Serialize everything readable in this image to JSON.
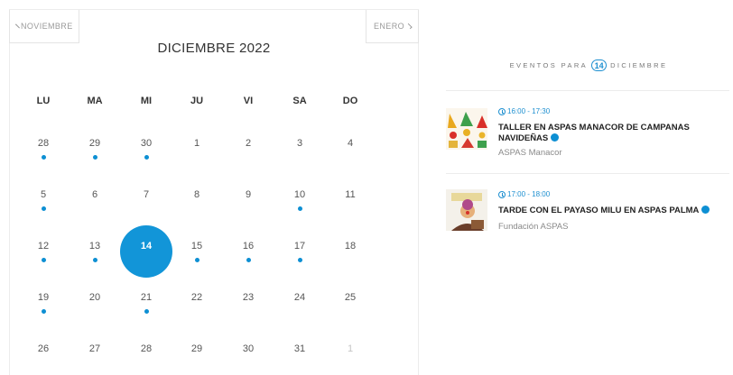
{
  "calendar": {
    "prev_label": "NOVIEMBRE",
    "next_label": "ENERO",
    "title": "DICIEMBRE 2022",
    "weekdays": [
      "LU",
      "MA",
      "MI",
      "JU",
      "VI",
      "SA",
      "DO"
    ],
    "weeks": [
      [
        {
          "d": "28",
          "dot": true
        },
        {
          "d": "29",
          "dot": true
        },
        {
          "d": "30",
          "dot": true
        },
        {
          "d": "1"
        },
        {
          "d": "2"
        },
        {
          "d": "3"
        },
        {
          "d": "4"
        }
      ],
      [
        {
          "d": "5",
          "dot": true
        },
        {
          "d": "6"
        },
        {
          "d": "7"
        },
        {
          "d": "8"
        },
        {
          "d": "9"
        },
        {
          "d": "10",
          "dot": true
        },
        {
          "d": "11"
        }
      ],
      [
        {
          "d": "12",
          "dot": true
        },
        {
          "d": "13",
          "dot": true
        },
        {
          "d": "14",
          "selected": true
        },
        {
          "d": "15",
          "dot": true
        },
        {
          "d": "16",
          "dot": true
        },
        {
          "d": "17",
          "dot": true
        },
        {
          "d": "18"
        }
      ],
      [
        {
          "d": "19",
          "dot": true
        },
        {
          "d": "20"
        },
        {
          "d": "21",
          "dot": true
        },
        {
          "d": "22"
        },
        {
          "d": "23"
        },
        {
          "d": "24"
        },
        {
          "d": "25"
        }
      ],
      [
        {
          "d": "26"
        },
        {
          "d": "27"
        },
        {
          "d": "28"
        },
        {
          "d": "29"
        },
        {
          "d": "30"
        },
        {
          "d": "31"
        },
        {
          "d": "1",
          "muted": true
        }
      ]
    ],
    "accent_color": "#1295d8"
  },
  "events_panel": {
    "header_prefix": "EVENTOS PARA",
    "header_day": "14",
    "header_suffix": "DICIEMBRE",
    "events": [
      {
        "time": "16:00 - 17:30",
        "title": "TALLER EN ASPAS MANACOR DE CAMPANAS NAVIDEÑAS",
        "organizer": "ASPAS Manacor"
      },
      {
        "time": "17:00 - 18:00",
        "title": "TARDE CON EL PAYASO MILU EN ASPAS PALMA",
        "organizer": "Fundación ASPAS"
      }
    ]
  }
}
